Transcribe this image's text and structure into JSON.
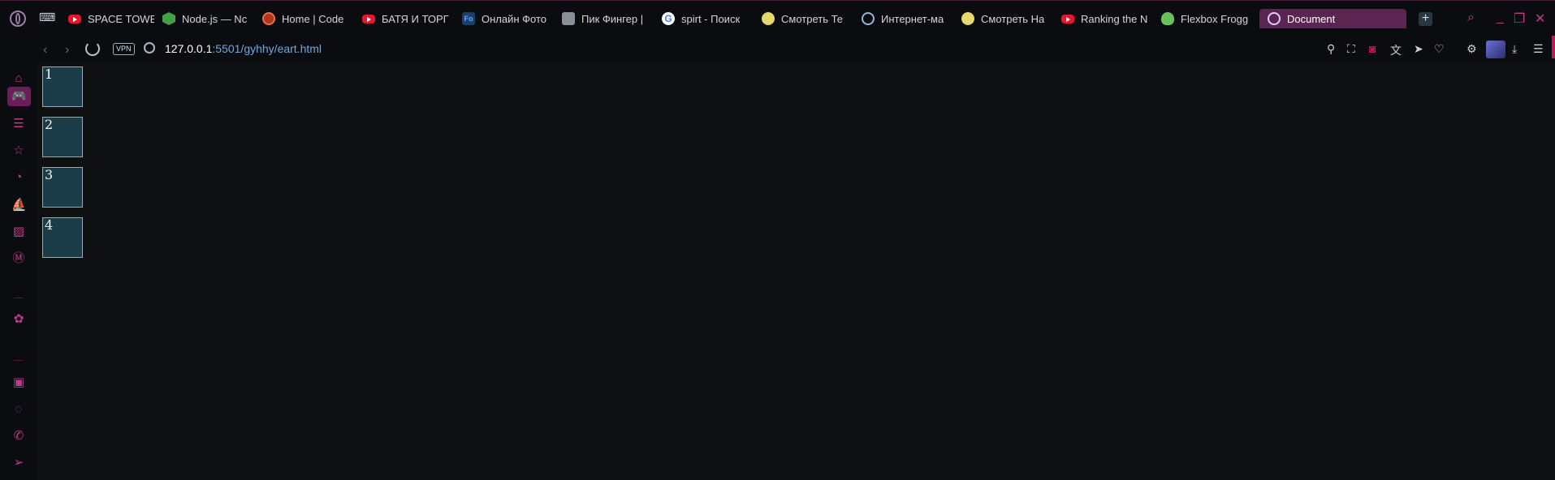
{
  "browser": {
    "tabs": [
      {
        "label": "SPACE TOWE",
        "icon": "youtube-icon"
      },
      {
        "label": "Node.js — Nc",
        "icon": "nodejs-icon"
      },
      {
        "label": "Home | Code",
        "icon": "codewars-icon"
      },
      {
        "label": "БАТЯ И ТОРГ",
        "icon": "youtube-icon"
      },
      {
        "label": "Онлайн Фото",
        "icon": "fotor-icon"
      },
      {
        "label": "Пик Фингер |",
        "icon": "page-icon"
      },
      {
        "label": "spirt - Поиск",
        "icon": "google-icon"
      },
      {
        "label": "Смотреть Те",
        "icon": "anime-icon"
      },
      {
        "label": "Интернет-ма",
        "icon": "globe-icon"
      },
      {
        "label": "Смотреть На",
        "icon": "anime-icon"
      },
      {
        "label": "Ranking the N",
        "icon": "youtube-icon"
      },
      {
        "label": "Flexbox Frogg",
        "icon": "frog-icon"
      }
    ],
    "active_tab": {
      "label": "Document",
      "icon": "globe-icon"
    },
    "new_tab_label": "+",
    "address": {
      "vpn_label": "VPN",
      "host": "127.0.0.1",
      "path": ":5501/gyhhy/eart.html"
    },
    "colors": {
      "accent": "#c23a8a",
      "active_tab": "#5b2552",
      "background": "#0f1012",
      "box_fill": "#1b3d49"
    }
  },
  "page": {
    "boxes": [
      "1",
      "2",
      "3",
      "4"
    ]
  }
}
